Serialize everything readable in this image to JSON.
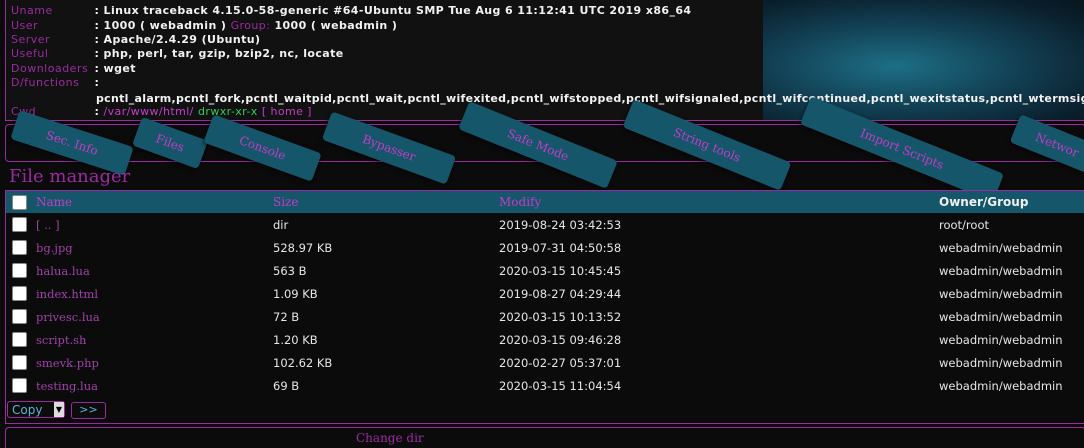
{
  "info": {
    "rows": [
      {
        "key": "Uname",
        "value": ": Linux traceback 4.15.0-58-generic #64-Ubuntu SMP Tue Aug 6 11:12:41 UTC 2019 x86_64"
      },
      {
        "key": "User",
        "value": ": 1000 ( webadmin )",
        "group_label": "Group:",
        "group_value": "1000 ( webadmin )"
      },
      {
        "key": "Server",
        "value": ": Apache/2.4.29 (Ubuntu)"
      },
      {
        "key": "Useful",
        "value": ": php, perl, tar, gzip, bzip2, nc, locate"
      },
      {
        "key": "Downloaders",
        "value": ": wget"
      },
      {
        "key": "D/functions",
        "value": ":"
      },
      {
        "key": "Cwd",
        "path_prefix": ": ",
        "path": "/var/www/html/",
        "perms": "drwxr-xr-x",
        "home": "[ home ]"
      }
    ],
    "disabled_functions": "pcntl_alarm,pcntl_fork,pcntl_waitpid,pcntl_wait,pcntl_wifexited,pcntl_wifstopped,pcntl_wifsignaled,pcntl_wifcontinued,pcntl_wexitstatus,pcntl_wtermsig,pcntl_w"
  },
  "tabs": [
    "Sec. Info",
    "Files",
    "Console",
    "Bypasser",
    "Safe Mode",
    "String tools",
    "Import Scripts",
    "Networ"
  ],
  "file_manager": {
    "title": "File manager",
    "columns": [
      "Name",
      "Size",
      "Modify",
      "Owner/Group"
    ],
    "rows": [
      {
        "name": "[ .. ]",
        "size": "dir",
        "modify": "2019-08-24 03:42:53",
        "owner": "root/root"
      },
      {
        "name": "bg.jpg",
        "size": "528.97 KB",
        "modify": "2019-07-31 04:50:58",
        "owner": "webadmin/webadmin"
      },
      {
        "name": "halua.lua",
        "size": "563 B",
        "modify": "2020-03-15 10:45:45",
        "owner": "webadmin/webadmin"
      },
      {
        "name": "index.html",
        "size": "1.09 KB",
        "modify": "2019-08-27 04:29:44",
        "owner": "webadmin/webadmin"
      },
      {
        "name": "privesc.lua",
        "size": "72 B",
        "modify": "2020-03-15 10:13:52",
        "owner": "webadmin/webadmin"
      },
      {
        "name": "script.sh",
        "size": "1.20 KB",
        "modify": "2020-03-15 09:46:28",
        "owner": "webadmin/webadmin"
      },
      {
        "name": "smevk.php",
        "size": "102.62 KB",
        "modify": "2020-02-27 05:37:01",
        "owner": "webadmin/webadmin"
      },
      {
        "name": "testing.lua",
        "size": "69 B",
        "modify": "2020-03-15 11:04:54",
        "owner": "webadmin/webadmin"
      }
    ]
  },
  "actions": {
    "select_value": "Copy",
    "go_label": ">>"
  },
  "bottom_panel": {
    "title": "Change dir"
  },
  "colors": {
    "accent": "#9b2aa0",
    "tab_bg": "#15566a",
    "link": "#c33cc6",
    "ok": "#33cc55"
  }
}
